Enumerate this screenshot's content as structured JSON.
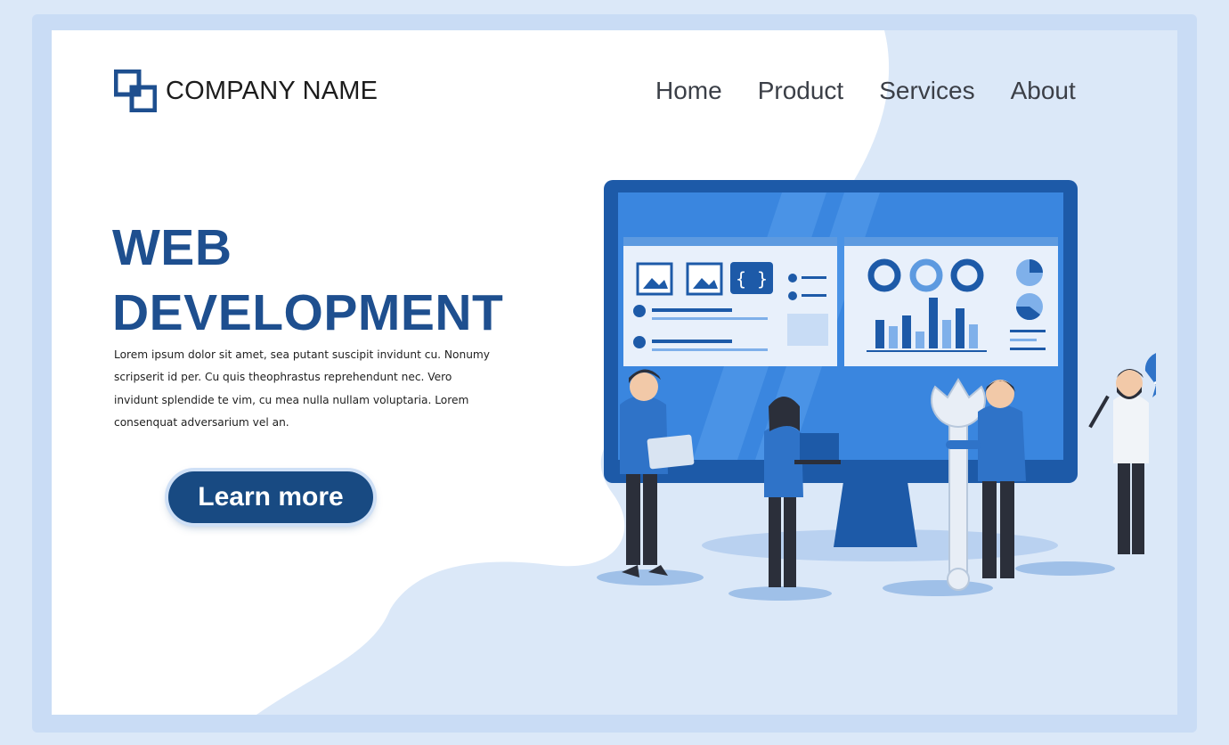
{
  "brand": {
    "name": "COMPANY NAME",
    "logo_icon": "overlapping-squares-icon"
  },
  "nav": {
    "items": [
      "Home",
      "Product",
      "Services",
      "About"
    ]
  },
  "hero": {
    "title_line1": "WEB",
    "title_line2": "DEVELOPMENT",
    "description": "Lorem ipsum dolor sit amet, sea putant suscipit invidunt cu. Nonumy scripserit id per. Cu quis theophrastus reprehendunt nec. Vero invidunt splendide te vim, cu mea nulla nullam voluptaria. Lorem consenquat adversarium vel an.",
    "cta_label": "Learn more"
  },
  "illustration": {
    "code_badge": "{ }",
    "speech_badge": "</>"
  },
  "colors": {
    "brand_blue": "#1e4f8f",
    "button_blue": "#184a82",
    "accent_blue": "#2f73c8",
    "light_blue": "#c9dcf5"
  }
}
